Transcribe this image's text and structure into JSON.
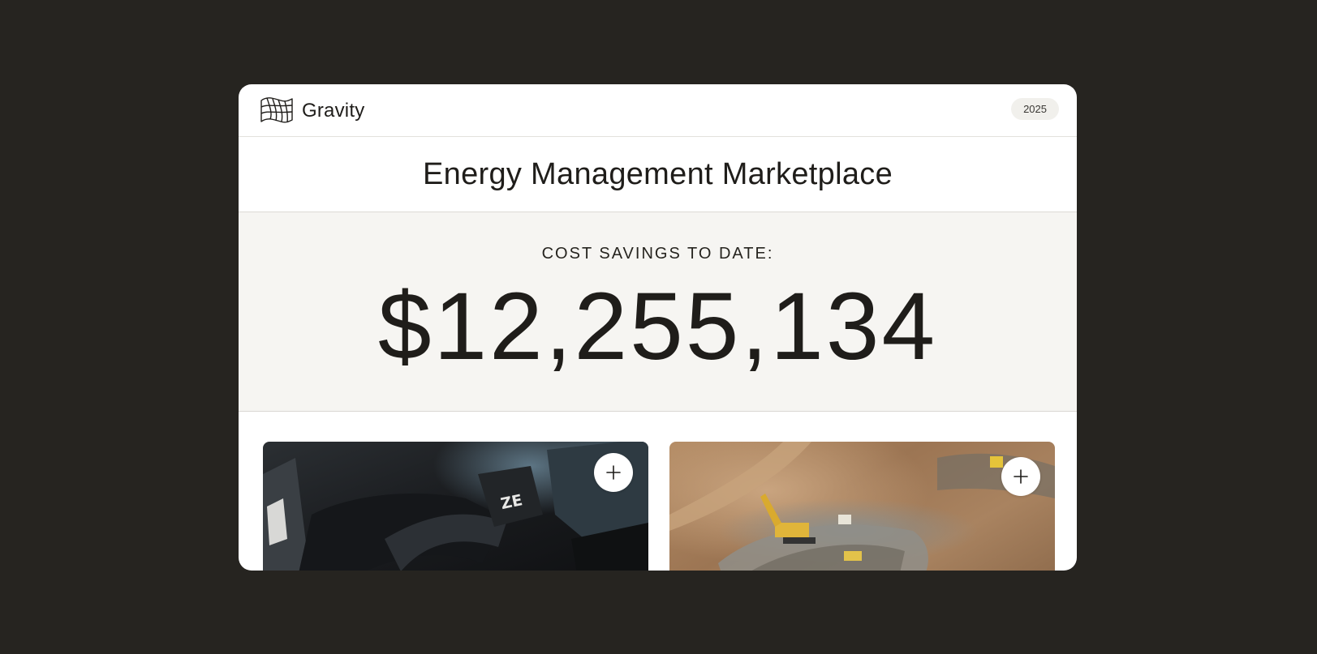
{
  "brand": {
    "name": "Gravity",
    "logo_icon": "flag-wave-icon"
  },
  "header": {
    "year_badge": "2025"
  },
  "main": {
    "title": "Energy Management Marketplace",
    "savings_label": "COST SAVINGS TO DATE:",
    "savings_value": "$12,255,134"
  },
  "tiles": [
    {
      "image": "ev-charging-plug-photo",
      "image_text": "ZE",
      "action_icon": "plus-icon"
    },
    {
      "image": "construction-excavation-site-photo",
      "action_icon": "plus-icon"
    }
  ],
  "colors": {
    "page_background": "#262420",
    "card_background": "#ffffff",
    "savings_background": "#f6f5f2",
    "text": "#1f1d1a"
  }
}
